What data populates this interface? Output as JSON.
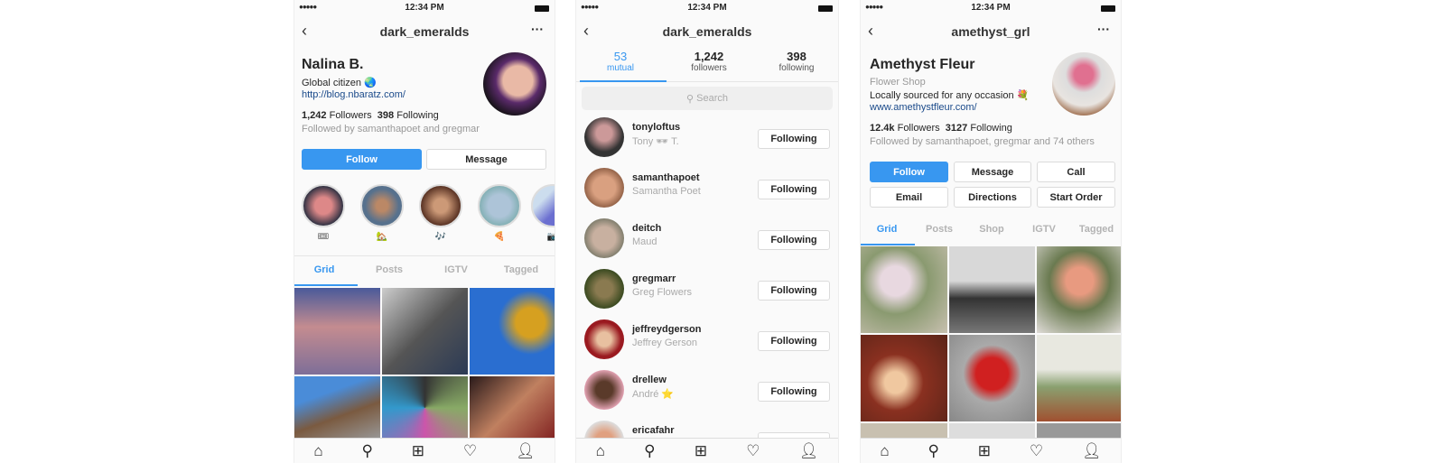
{
  "status": {
    "time": "12:34 PM"
  },
  "left": {
    "title": "dark_emeralds",
    "name": "Nalina B.",
    "bio": "Global citizen 🌏",
    "link": "http://blog.nbaratz.com/",
    "followers_count": "1,242",
    "followers_label": "Followers",
    "following_count": "398",
    "following_label": "Following",
    "followed_by": "Followed by samanthapoet and gregmar",
    "follow": "Follow",
    "message": "Message",
    "highlights": [
      "🎟",
      "🏡",
      "🎶",
      "🍕",
      "📷"
    ],
    "tabs": [
      "Grid",
      "Posts",
      "IGTV",
      "Tagged"
    ]
  },
  "middle": {
    "title": "dark_emeralds",
    "tabs": [
      {
        "count": "53",
        "label": "mutual"
      },
      {
        "count": "1,242",
        "label": "followers"
      },
      {
        "count": "398",
        "label": "following"
      }
    ],
    "search_placeholder": "Search",
    "users": [
      {
        "username": "tonyloftus",
        "name": "Tony 🕶 T.",
        "button": "Following"
      },
      {
        "username": "samanthapoet",
        "name": "Samantha Poet",
        "button": "Following"
      },
      {
        "username": "deitch",
        "name": "Maud",
        "button": "Following"
      },
      {
        "username": "gregmarr",
        "name": "Greg Flowers",
        "button": "Following"
      },
      {
        "username": "jeffreydgerson",
        "name": "Jeffrey Gerson",
        "button": "Following"
      },
      {
        "username": "drellew",
        "name": "André ⭐",
        "button": "Following"
      },
      {
        "username": "ericafahr",
        "name": "",
        "button": "Following"
      }
    ]
  },
  "right": {
    "title": "amethyst_grl",
    "name": "Amethyst Fleur",
    "category": "Flower Shop",
    "bio": "Locally sourced for any occasion 💐",
    "link": "www.amethystfleur.com/",
    "followers_count": "12.4k",
    "followers_label": "Followers",
    "following_count": "3127",
    "following_label": "Following",
    "followed_by": "Followed by samanthapoet, gregmar and 74 others",
    "buttons": [
      "Follow",
      "Message",
      "Call",
      "Email",
      "Directions",
      "Start Order"
    ],
    "tabs": [
      "Grid",
      "Posts",
      "Shop",
      "IGTV",
      "Tagged"
    ]
  },
  "colors": {
    "accent": "#3897f0",
    "link": "#1a4a8a"
  }
}
